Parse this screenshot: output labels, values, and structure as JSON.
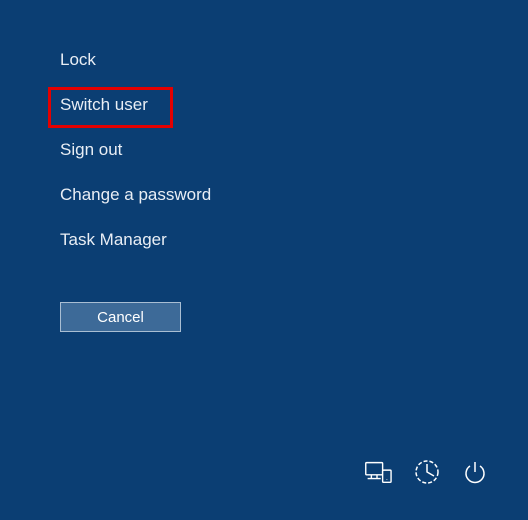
{
  "menu": {
    "items": [
      {
        "label": "Lock"
      },
      {
        "label": "Switch user"
      },
      {
        "label": "Sign out"
      },
      {
        "label": "Change a password"
      },
      {
        "label": "Task Manager"
      }
    ]
  },
  "cancel_label": "Cancel",
  "highlight_index": 1,
  "icons": {
    "network": "network-icon",
    "ease_of_access": "ease-of-access-icon",
    "power": "power-icon"
  }
}
